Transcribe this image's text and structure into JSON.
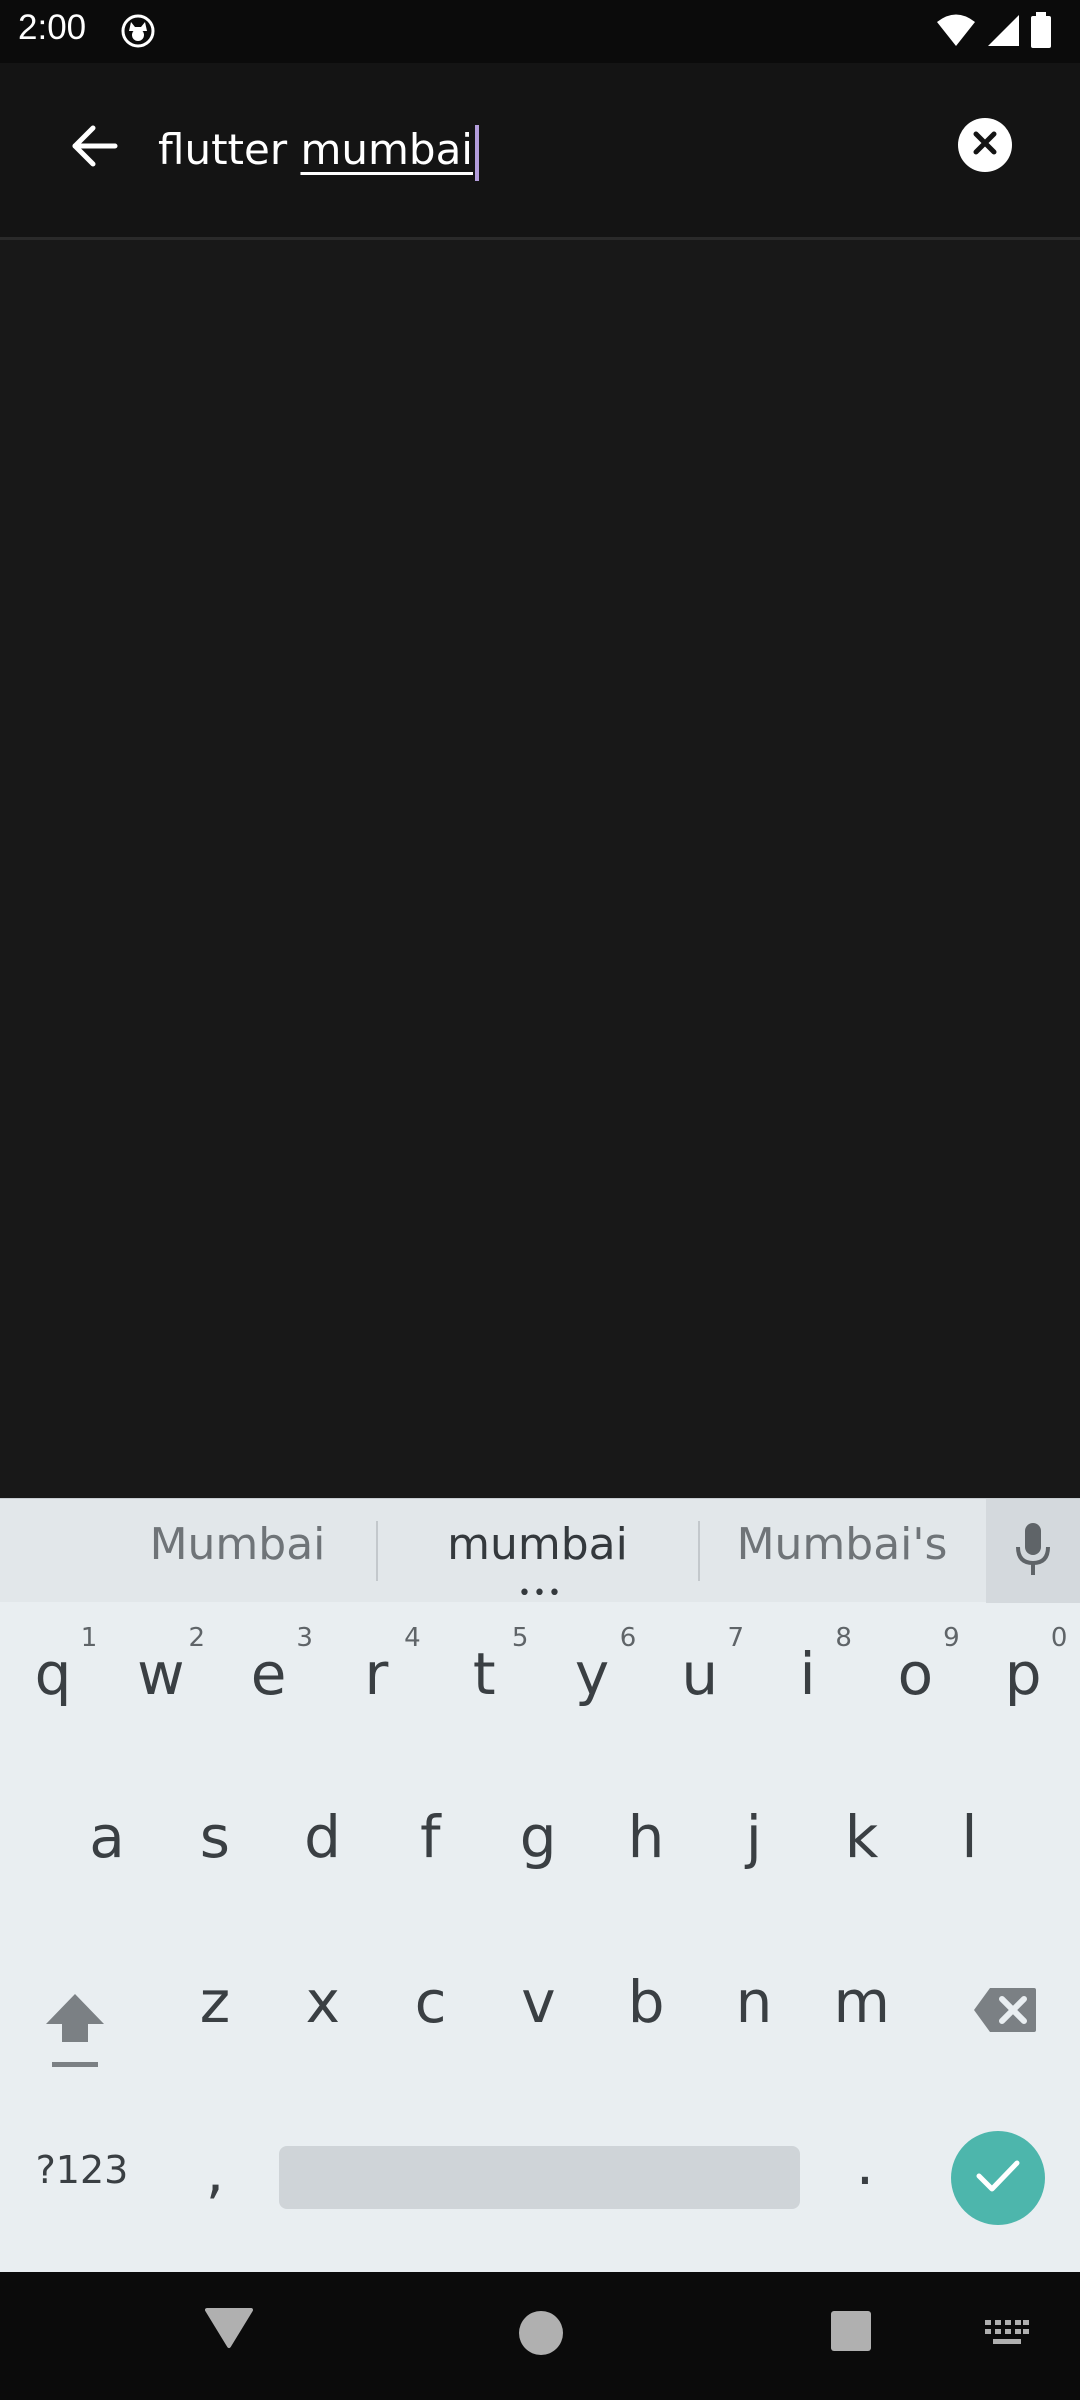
{
  "status_bar": {
    "time": "2:00",
    "app_icon": "cat-notification-icon",
    "icons": [
      "wifi-icon",
      "signal-icon",
      "battery-icon"
    ]
  },
  "search": {
    "query_prefix": "flutter ",
    "query_composing": "mumbai",
    "back_icon": "arrow-left-icon",
    "clear_icon": "close-circle-icon"
  },
  "keyboard": {
    "suggestions": [
      "Mumbai",
      "mumbai",
      "Mumbai's"
    ],
    "more_indicator": "•••",
    "rows": [
      [
        "q",
        "w",
        "e",
        "r",
        "t",
        "y",
        "u",
        "i",
        "o",
        "p"
      ],
      [
        "a",
        "s",
        "d",
        "f",
        "g",
        "h",
        "j",
        "k",
        "l"
      ],
      [
        "z",
        "x",
        "c",
        "v",
        "b",
        "n",
        "m"
      ]
    ],
    "number_hints": [
      "1",
      "2",
      "3",
      "4",
      "5",
      "6",
      "7",
      "8",
      "9",
      "0"
    ],
    "symbols_label": "?123",
    "comma_label": ",",
    "period_label": ".",
    "icons": {
      "mic": "microphone-icon",
      "shift": "shift-icon",
      "backspace": "backspace-icon",
      "enter": "checkmark-icon"
    },
    "colors": {
      "enter_key": "#4db6ac",
      "background": "#e9eef1"
    }
  },
  "nav_bar": {
    "icons": [
      "back-triangle-icon",
      "home-circle-icon",
      "recents-square-icon",
      "keyboard-switch-icon"
    ]
  },
  "colors": {
    "cursor": "#b39ddb",
    "app_background": "#181818"
  }
}
